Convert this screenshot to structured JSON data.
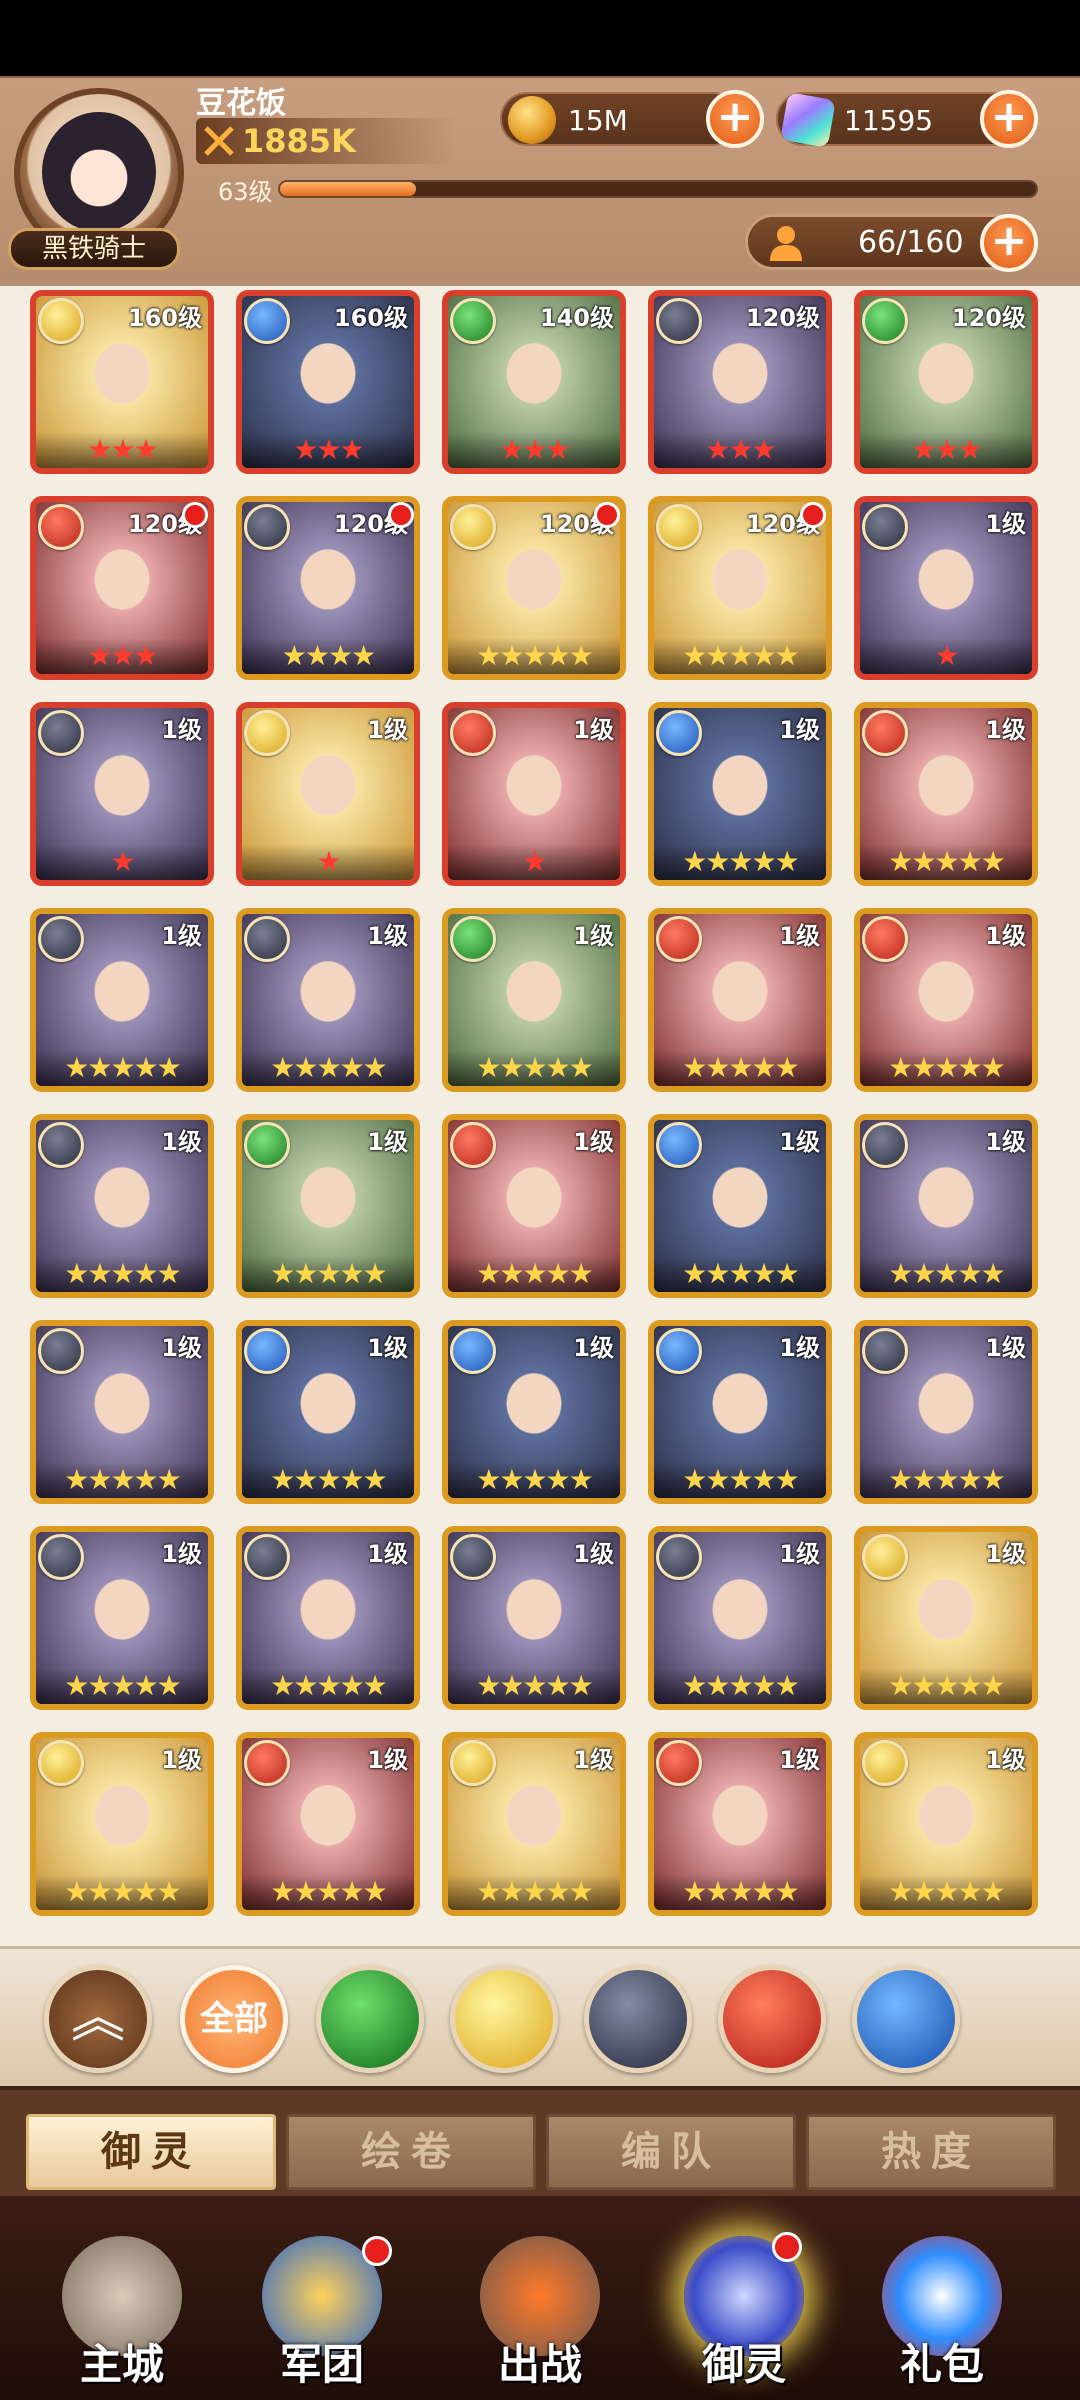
{
  "header": {
    "player_name": "豆花饭",
    "power": "1885K",
    "level_label": "63级",
    "exp_progress": 0.18,
    "rank_title": "黑铁骑士",
    "gold": "15M",
    "gems": "11595",
    "roster": "66/160"
  },
  "cards": [
    {
      "element": "light",
      "level": "160级",
      "stars": "★★★",
      "frame": "red",
      "dot": false
    },
    {
      "element": "ice",
      "level": "160级",
      "stars": "★★★",
      "frame": "red",
      "dot": false
    },
    {
      "element": "wind",
      "level": "140级",
      "stars": "★★★",
      "frame": "red",
      "dot": false
    },
    {
      "element": "dark",
      "level": "120级",
      "stars": "★★★",
      "frame": "red",
      "dot": false
    },
    {
      "element": "wind",
      "level": "120级",
      "stars": "★★★",
      "frame": "red",
      "dot": false
    },
    {
      "element": "fire",
      "level": "120级",
      "stars": "★★★",
      "frame": "red",
      "dot": true
    },
    {
      "element": "dark",
      "level": "120级",
      "stars": "★★★★",
      "frame": "gold",
      "dot": true
    },
    {
      "element": "light",
      "level": "120级",
      "stars": "★★★★★",
      "frame": "gold",
      "dot": true
    },
    {
      "element": "light",
      "level": "120级",
      "stars": "★★★★★",
      "frame": "gold",
      "dot": true
    },
    {
      "element": "dark",
      "level": "1级",
      "stars": "★",
      "frame": "red",
      "dot": false
    },
    {
      "element": "dark",
      "level": "1级",
      "stars": "★",
      "frame": "red",
      "dot": false
    },
    {
      "element": "light",
      "level": "1级",
      "stars": "★",
      "frame": "red",
      "dot": false
    },
    {
      "element": "fire",
      "level": "1级",
      "stars": "★",
      "frame": "red",
      "dot": false
    },
    {
      "element": "ice",
      "level": "1级",
      "stars": "★★★★★",
      "frame": "gold",
      "dot": false
    },
    {
      "element": "fire",
      "level": "1级",
      "stars": "★★★★★",
      "frame": "gold",
      "dot": false
    },
    {
      "element": "dark",
      "level": "1级",
      "stars": "★★★★★",
      "frame": "gold",
      "dot": false
    },
    {
      "element": "dark",
      "level": "1级",
      "stars": "★★★★★",
      "frame": "gold",
      "dot": false
    },
    {
      "element": "wind",
      "level": "1级",
      "stars": "★★★★★",
      "frame": "gold",
      "dot": false
    },
    {
      "element": "fire",
      "level": "1级",
      "stars": "★★★★★",
      "frame": "gold",
      "dot": false
    },
    {
      "element": "fire",
      "level": "1级",
      "stars": "★★★★★",
      "frame": "gold",
      "dot": false
    },
    {
      "element": "dark",
      "level": "1级",
      "stars": "★★★★★",
      "frame": "gold",
      "dot": false
    },
    {
      "element": "wind",
      "level": "1级",
      "stars": "★★★★★",
      "frame": "gold",
      "dot": false
    },
    {
      "element": "fire",
      "level": "1级",
      "stars": "★★★★★",
      "frame": "gold",
      "dot": false
    },
    {
      "element": "ice",
      "level": "1级",
      "stars": "★★★★★",
      "frame": "gold",
      "dot": false
    },
    {
      "element": "dark",
      "level": "1级",
      "stars": "★★★★★",
      "frame": "gold",
      "dot": false
    },
    {
      "element": "dark",
      "level": "1级",
      "stars": "★★★★★",
      "frame": "gold",
      "dot": false
    },
    {
      "element": "ice",
      "level": "1级",
      "stars": "★★★★★",
      "frame": "gold",
      "dot": false
    },
    {
      "element": "ice",
      "level": "1级",
      "stars": "★★★★★",
      "frame": "gold",
      "dot": false
    },
    {
      "element": "ice",
      "level": "1级",
      "stars": "★★★★★",
      "frame": "gold",
      "dot": false
    },
    {
      "element": "dark",
      "level": "1级",
      "stars": "★★★★★",
      "frame": "gold",
      "dot": false
    },
    {
      "element": "dark",
      "level": "1级",
      "stars": "★★★★★",
      "frame": "gold",
      "dot": false
    },
    {
      "element": "dark",
      "level": "1级",
      "stars": "★★★★★",
      "frame": "gold",
      "dot": false
    },
    {
      "element": "dark",
      "level": "1级",
      "stars": "★★★★★",
      "frame": "gold",
      "dot": false
    },
    {
      "element": "dark",
      "level": "1级",
      "stars": "★★★★★",
      "frame": "gold",
      "dot": false
    },
    {
      "element": "light",
      "level": "1级",
      "stars": "★★★★★",
      "frame": "gold",
      "dot": false
    },
    {
      "element": "light",
      "level": "1级",
      "stars": "★★★★★",
      "frame": "gold",
      "dot": false
    },
    {
      "element": "fire",
      "level": "1级",
      "stars": "★★★★★",
      "frame": "gold",
      "dot": false
    },
    {
      "element": "light",
      "level": "1级",
      "stars": "★★★★★",
      "frame": "gold",
      "dot": false
    },
    {
      "element": "fire",
      "level": "1级",
      "stars": "★★★★★",
      "frame": "gold",
      "dot": false
    },
    {
      "element": "light",
      "level": "1级",
      "stars": "★★★★★",
      "frame": "gold",
      "dot": false
    }
  ],
  "filters": {
    "up_icon": "chevron-double-up-icon",
    "all_label": "全部",
    "elements": [
      "wind",
      "light",
      "dark",
      "fire",
      "ice"
    ]
  },
  "section_tabs": [
    "御灵",
    "绘卷",
    "编队",
    "热度"
  ],
  "section_active": 0,
  "nav": [
    {
      "label": "主城",
      "icon": "city-icon",
      "dot": false
    },
    {
      "label": "军团",
      "icon": "legion-icon",
      "dot": true
    },
    {
      "label": "出战",
      "icon": "battle-icon",
      "dot": false
    },
    {
      "label": "御灵",
      "icon": "spirit-crystal-icon",
      "dot": true,
      "active": true
    },
    {
      "label": "礼包",
      "icon": "gift-shop-icon",
      "dot": false
    }
  ],
  "colors": {
    "header_bg": "#c79e7f",
    "grid_bg": "#f4ede1",
    "gold_frame": "#dd9a20",
    "red_frame": "#d8402b",
    "accent_orange": "#e56d1e"
  }
}
